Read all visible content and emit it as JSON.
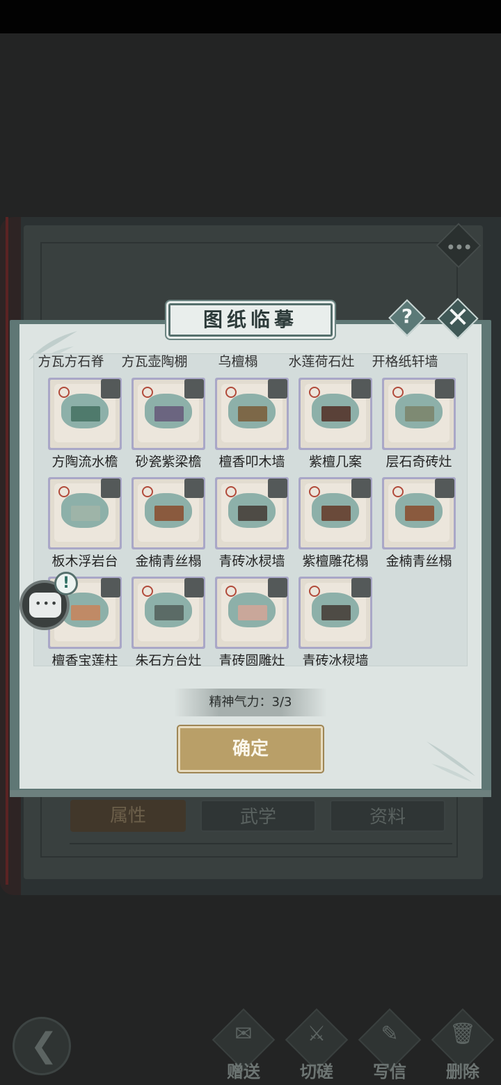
{
  "modal": {
    "title": "图纸临摹",
    "help_label": "?",
    "close_label": "✕",
    "partial_row": [
      "方瓦方石脊",
      "方瓦壶陶棚",
      "乌檀榻",
      "水莲荷石灶",
      "开格纸轩墙"
    ],
    "items": [
      {
        "label": "方陶流水檐",
        "accent": "#4f7a6c"
      },
      {
        "label": "砂瓷紫梁檐",
        "accent": "#6b6580"
      },
      {
        "label": "檀香叩木墙",
        "accent": "#7d6848"
      },
      {
        "label": "紫檀几案",
        "accent": "#5a4138"
      },
      {
        "label": "层石奇砖灶",
        "accent": "#7e8a73"
      },
      {
        "label": "板木浮岩台",
        "accent": "#9eb4a8"
      },
      {
        "label": "金楠青丝榻",
        "accent": "#8a5a3e"
      },
      {
        "label": "青砖冰棂墙",
        "accent": "#4e4b45"
      },
      {
        "label": "紫檀雕花榻",
        "accent": "#6a4a3a"
      },
      {
        "label": "金楠青丝榻",
        "accent": "#8a5a3e"
      },
      {
        "label": "檀香宝莲柱",
        "accent": "#c08a66"
      },
      {
        "label": "朱石方台灶",
        "accent": "#5b6b66"
      },
      {
        "label": "青砖圆雕灶",
        "accent": "#c9a79a"
      },
      {
        "label": "青砖冰棂墙",
        "accent": "#4e4b45"
      }
    ],
    "stamina_text": "精神气力：3/3",
    "confirm_label": "确定"
  },
  "background": {
    "tabs": [
      "属性",
      "武学",
      "资料"
    ],
    "menu_dots": "•••"
  },
  "bottom_nav": {
    "back_glyph": "❮",
    "items": [
      {
        "label": "赠送",
        "icon": "scroll-icon",
        "glyph": "✉"
      },
      {
        "label": "切磋",
        "icon": "swords-icon",
        "glyph": "⚔"
      },
      {
        "label": "写信",
        "icon": "letter-icon",
        "glyph": "✎"
      },
      {
        "label": "删除",
        "icon": "trash-icon",
        "glyph": "🗑"
      }
    ]
  },
  "chat": {
    "dots": "•••",
    "alert": "!"
  }
}
